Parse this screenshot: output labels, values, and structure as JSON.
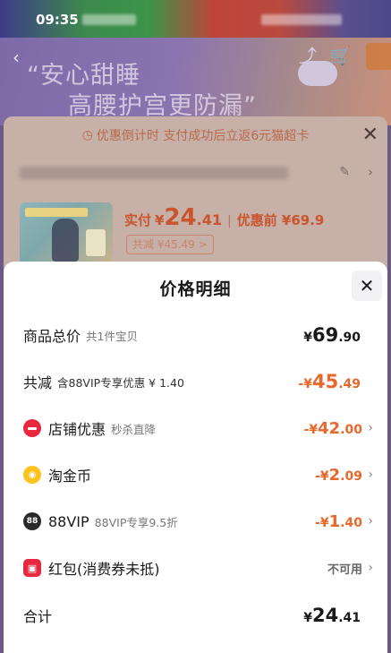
{
  "status_bar": {
    "time": "09:35"
  },
  "background_page": {
    "hero_line1": "“安心甜睡",
    "hero_line2": "高腰护宫更防漏”",
    "countdown_text": "优惠倒计时  支付成功后立返6元猫超卡",
    "price": {
      "paid_label": "实付",
      "currency": "¥",
      "integer": "24",
      "decimal": ".41",
      "separator": "|",
      "before_label": "优惠前 ¥69.9"
    },
    "reduce_chip": "共减 ¥45.49 >"
  },
  "sheet": {
    "title": "价格明细",
    "rows": [
      {
        "label": "商品总价",
        "sub": "共1件宝贝",
        "cur": "¥",
        "int": "69",
        "dec": ".90",
        "color": "black"
      },
      {
        "label": "共减",
        "sub": "含88VIP专享优惠 ¥ 1.40",
        "cur": "-¥",
        "int": "45",
        "dec": ".49",
        "color": "orange"
      },
      {
        "label": "店铺优惠",
        "sub": "秒杀直降",
        "icon": "shop-icon",
        "cur": "-¥",
        "int": "42",
        "dec": ".00",
        "color": "orange"
      },
      {
        "label": "淘金币",
        "sub": "",
        "icon": "coin-icon",
        "cur": "-¥",
        "int": "2",
        "dec": ".09",
        "color": "orange"
      },
      {
        "label": "88VIP",
        "sub": "88VIP专享9.5折",
        "icon": "vip-icon",
        "cur": "-¥",
        "int": "1",
        "dec": ".40",
        "color": "orange"
      },
      {
        "label": "红包(消费券未抵)",
        "sub": "",
        "icon": "red-packet-icon",
        "value_text": "不可用"
      },
      {
        "label": "合计",
        "sub": "",
        "cur": "¥",
        "int": "24",
        "dec": ".41",
        "color": "black"
      }
    ]
  },
  "colors": {
    "accent_orange": "#e8672a",
    "shop_red": "#e8283e",
    "coin_yellow": "#ffc21f"
  }
}
